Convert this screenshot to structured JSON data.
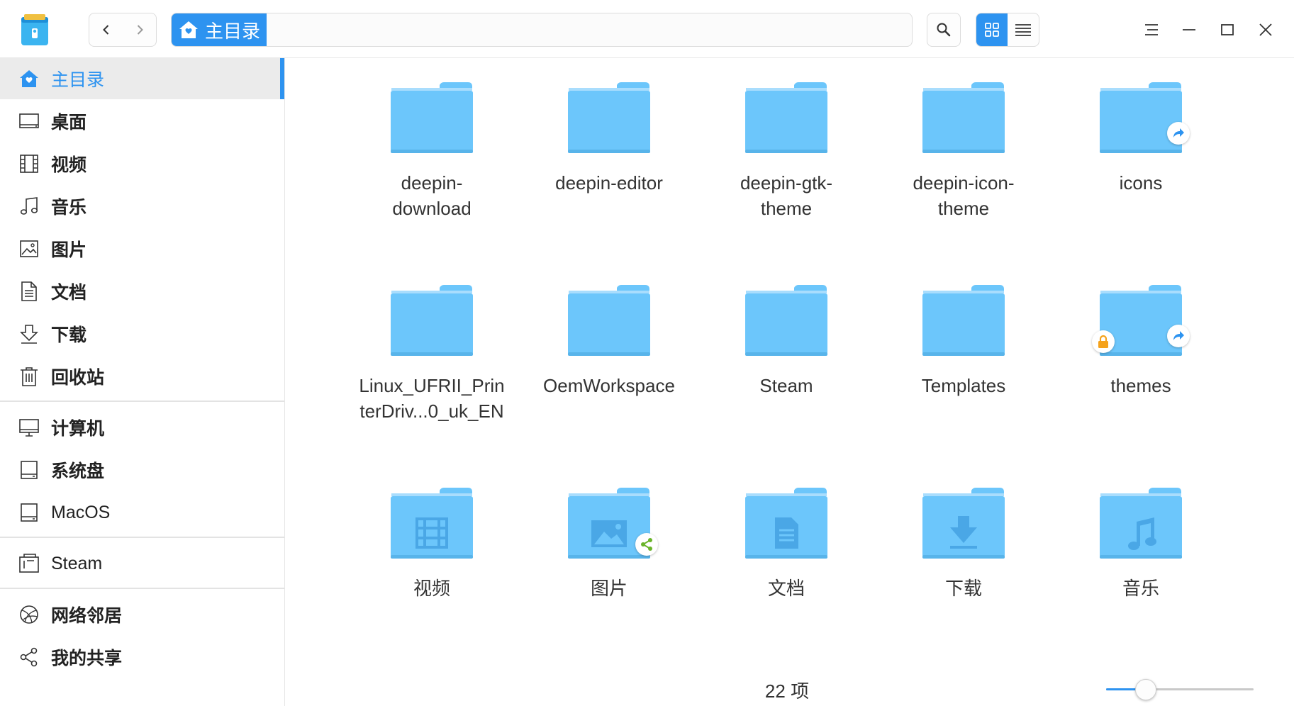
{
  "colors": {
    "accent": "#2d93f0",
    "folder": "#6cc6fb",
    "folder_glyph": "#4aa7e6",
    "lock_badge": "#f5a21b",
    "share_badge": "#6ab42b"
  },
  "window": {
    "app_icon": "file-manager-icon",
    "nav": {
      "back_icon": "chevron-left-icon",
      "forward_icon": "chevron-right-icon"
    },
    "breadcrumb": {
      "label": "主目录",
      "icon": "home-icon"
    },
    "search_icon": "search-icon",
    "view_modes": [
      {
        "name": "icon-view",
        "active": true
      },
      {
        "name": "list-view",
        "active": false
      }
    ],
    "controls": [
      "menu-icon",
      "minimize-icon",
      "maximize-icon",
      "close-icon"
    ]
  },
  "sidebar": {
    "groups": [
      [
        {
          "label": "主目录",
          "icon": "home-icon",
          "active": true
        },
        {
          "label": "桌面",
          "icon": "desktop-icon"
        },
        {
          "label": "视频",
          "icon": "video-icon"
        },
        {
          "label": "音乐",
          "icon": "music-icon"
        },
        {
          "label": "图片",
          "icon": "picture-icon"
        },
        {
          "label": "文档",
          "icon": "document-icon"
        },
        {
          "label": "下载",
          "icon": "download-icon"
        },
        {
          "label": "回收站",
          "icon": "trash-icon"
        }
      ],
      [
        {
          "label": "计算机",
          "icon": "computer-icon"
        },
        {
          "label": "系统盘",
          "icon": "disk-icon"
        },
        {
          "label": "MacOS",
          "icon": "disk-icon"
        }
      ],
      [
        {
          "label": "Steam",
          "icon": "steam-icon"
        }
      ],
      [
        {
          "label": "网络邻居",
          "icon": "network-icon"
        },
        {
          "label": "我的共享",
          "icon": "share-icon"
        }
      ]
    ]
  },
  "files": [
    {
      "name": "deepin-\ndownload"
    },
    {
      "name": "deepin-editor"
    },
    {
      "name": "deepin-gtk-\ntheme"
    },
    {
      "name": "deepin-icon-\ntheme"
    },
    {
      "name": "icons",
      "badges": [
        "symlink"
      ]
    },
    {
      "name": "Linux_UFRII_Prin\nterDriv...0_uk_EN"
    },
    {
      "name": "OemWorkspace"
    },
    {
      "name": "Steam"
    },
    {
      "name": "Templates"
    },
    {
      "name": "themes",
      "badges": [
        "lock",
        "symlink"
      ]
    },
    {
      "name": "视频",
      "glyph": "video"
    },
    {
      "name": "图片",
      "glyph": "picture",
      "badges": [
        "share"
      ]
    },
    {
      "name": "文档",
      "glyph": "document"
    },
    {
      "name": "下载",
      "glyph": "download"
    },
    {
      "name": "音乐",
      "glyph": "music"
    }
  ],
  "status": {
    "count_text": "22 项"
  },
  "zoom": {
    "level": 0.27
  }
}
